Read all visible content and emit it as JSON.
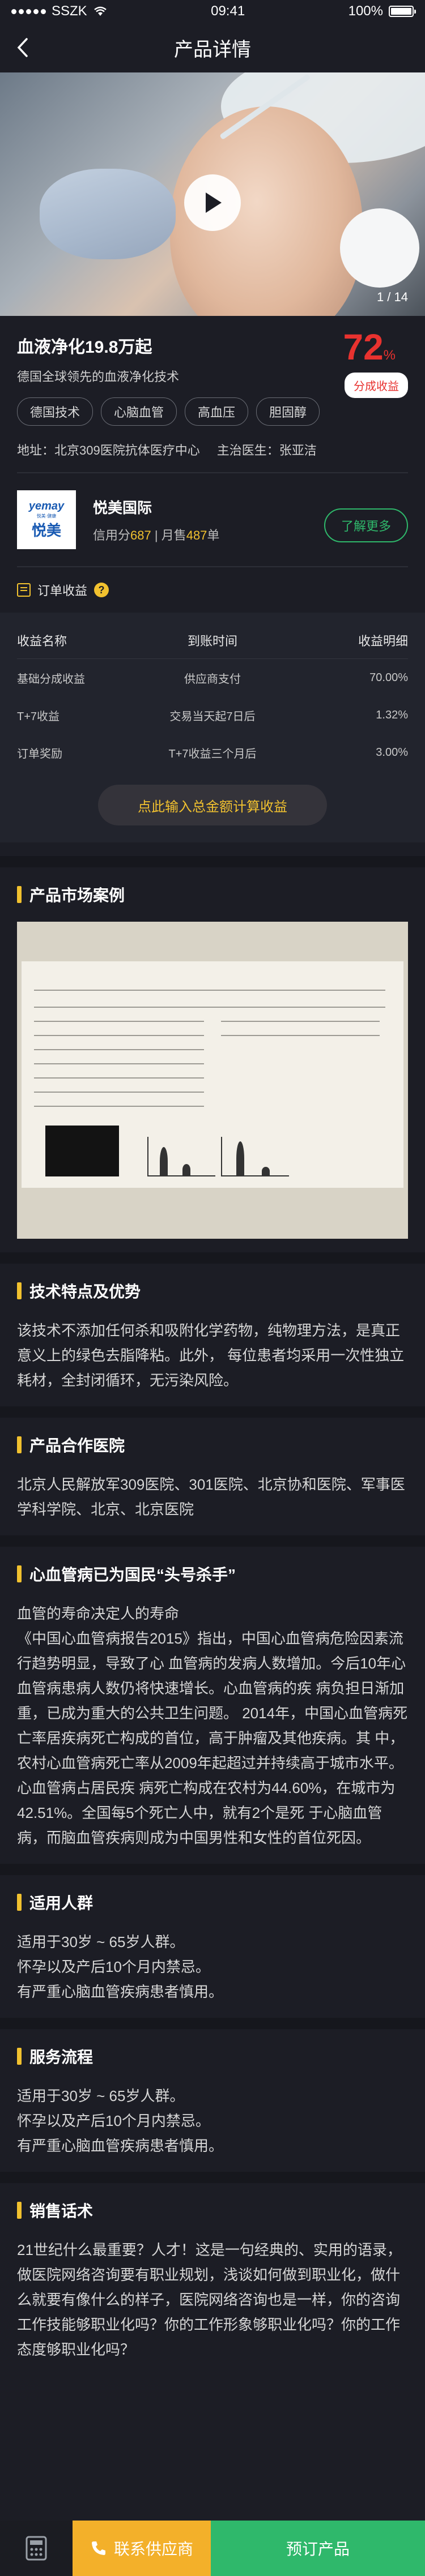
{
  "status_bar": {
    "carrier": "SSZK",
    "time": "09:41",
    "battery": "100%",
    "battery_level": 1.0
  },
  "nav": {
    "title": "产品详情"
  },
  "hero": {
    "page_indicator": "1 / 14"
  },
  "product": {
    "title": "血液净化19.8万起",
    "subtitle": "德国全球领先的血液净化技术",
    "percent": "72",
    "percent_unit": "%",
    "share_badge": "分成收益",
    "tags": [
      "德国技术",
      "心脑血管",
      "高血压",
      "胆固醇"
    ],
    "address": "地址：北京309医院抗体医疗中心",
    "doctor": "主治医生：张亚洁"
  },
  "supplier": {
    "logo_top": "yemay",
    "logo_mid": "悦美·健康",
    "logo_bottom": "悦美",
    "name": "悦美国际",
    "credit_label": "信用分",
    "credit": "687",
    "sold_label": "月售",
    "sold": "487",
    "sold_unit": "单",
    "more_button": "了解更多"
  },
  "revenue": {
    "title": "订单收益",
    "help": "?",
    "headers": [
      "收益名称",
      "到账时间",
      "收益明细"
    ],
    "rows": [
      [
        "基础分成收益",
        "供应商支付",
        "70.00%"
      ],
      [
        "T+7收益",
        "交易当天起7日后",
        "1.32%"
      ],
      [
        "订单奖励",
        "T+7收益三个月后",
        "3.00%"
      ]
    ],
    "calc_button": "点此输入总金额计算收益"
  },
  "sections": {
    "case": {
      "title": "产品市场案例"
    },
    "tech": {
      "title": "技术特点及优势",
      "body": "该技术不添加任何杀和吸附化学药物，纯物理方法，是真正意义上的绿色去脂降粘。此外， 每位患者均采用一次性独立耗材，全封闭循环，无污染风险。"
    },
    "hospitals": {
      "title": "产品合作医院",
      "body": "北京人民解放军309医院、301医院、北京协和医院、军事医学科学院、北京、北京医院"
    },
    "killer": {
      "title": "心血管病已为国民“头号杀手”",
      "body": "血管的寿命决定人的寿命\n《中国心血管病报告2015》指出，中国心血管病危险因素流行趋势明显，导致了心 血管病的发病人数增加。今后10年心血管病患病人数仍将快速增长。心血管病的疾 病负担日渐加重，已成为重大的公共卫生问题。 2014年，中国心血管病死亡率居疾病死亡构成的首位，高于肿瘤及其他疾病。其 中，农村心血管病死亡率从2009年起超过并持续高于城市水平。心血管病占居民疾 病死亡构成在农村为44.60%，在城市为42.51%。全国每5个死亡人中，就有2个是死 于心脑血管病，而脑血管疾病则成为中国男性和女性的首位死因。"
    },
    "crowd": {
      "title": "适用人群",
      "body": "适用于30岁 ~ 65岁人群。\n怀孕以及产后10个月内禁忌。\n有严重心脑血管疾病患者慎用。"
    },
    "process": {
      "title": "服务流程",
      "body": "适用于30岁 ~ 65岁人群。\n怀孕以及产后10个月内禁忌。\n有严重心脑血管疾病患者慎用。"
    },
    "talk": {
      "title": "销售话术",
      "body": "21世纪什么最重要？人才！这是一句经典的、实用的语录，做医院网络咨询要有职业规划，浅谈如何做到职业化，做什么就要有像什么的样子，医院网络咨询也是一样，你的咨询工作技能够职业化吗？你的工作形象够职业化吗？你的工作态度够职业化吗？"
    }
  },
  "bottom_bar": {
    "contact": "联系供应商",
    "book": "预订产品"
  },
  "colors": {
    "accent": "#f1c12f",
    "red": "#e8322f",
    "green": "#2fb86b",
    "orange": "#f3b02a",
    "bg": "#1c1d25"
  }
}
